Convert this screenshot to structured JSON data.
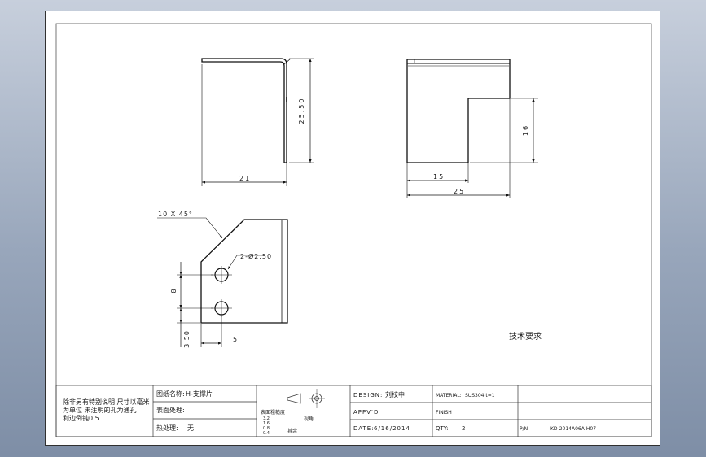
{
  "views": {
    "side": {
      "dim_width": "21",
      "dim_height": "25.50"
    },
    "front": {
      "dim_notch": "15",
      "dim_overall": "25",
      "dim_height": "16"
    },
    "flat": {
      "chamfer": "10 X 45°",
      "holes": "2-Ø2.50",
      "dim_spacing": "8",
      "dim_edge": "3.50",
      "dim_offset": "5"
    }
  },
  "tech_requirements": "技术要求",
  "title_block": {
    "notes": [
      "除非另有特别说明 尺寸以毫米",
      "为单位 未注明的孔为通孔",
      "利边倒钝0.5"
    ],
    "part_name_label": "图纸名称:",
    "part_name_value": "H-支撑片",
    "surface_label": "表面处理:",
    "heat_label": "热处理:",
    "heat_value": "无",
    "roughness_label": "表面粗糙度",
    "roughness_values": [
      "3.2",
      "1.6",
      "0.8",
      "0.4"
    ],
    "roughness_note": "其余",
    "angle_label": "视角",
    "design_label": "DESIGN:",
    "design_value": "刘校中",
    "approved_label": "APPV'D",
    "date_label": "DATE:",
    "date_value": "6/16/2014",
    "material_label": "MATERIAL:",
    "material_value": "SUS304 t=1",
    "finish_label": "FINISH",
    "qty_label": "QTY:",
    "qty_value": "2",
    "pn_label": "P/N",
    "pn_value": "KD-2014A06A-H07"
  }
}
